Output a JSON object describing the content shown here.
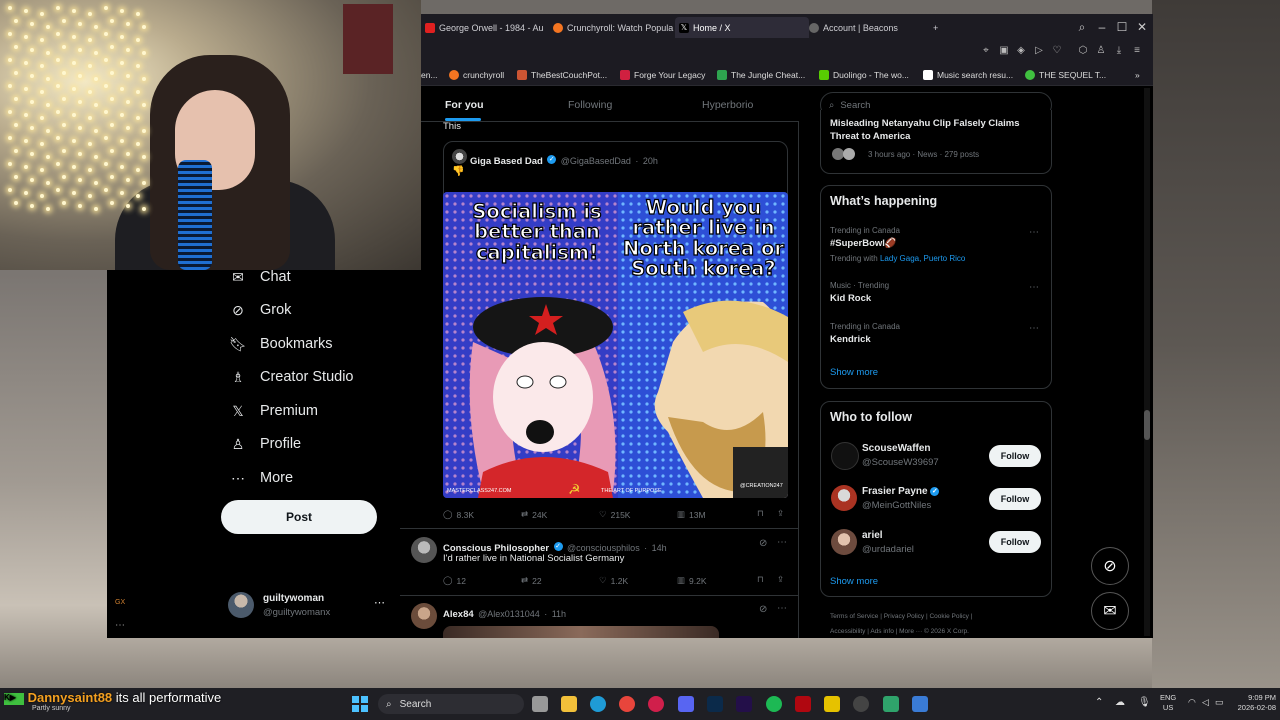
{
  "browser": {
    "tabs": [
      {
        "label": "George Orwell - 1984 - Au",
        "color": "#e02020"
      },
      {
        "label": "Crunchyroll: Watch Popula",
        "color": "#f47521"
      },
      {
        "label": "Home / X",
        "color": "#ffffff"
      },
      {
        "label": "Account | Beacons",
        "color": "#888888"
      }
    ],
    "bookmarks": [
      {
        "label": "en...",
        "color": "#888888"
      },
      {
        "label": "crunchyroll",
        "color": "#f47521"
      },
      {
        "label": "TheBestCouchPot...",
        "color": "#cc5533"
      },
      {
        "label": "Forge Your Legacy",
        "color": "#d02040"
      },
      {
        "label": "The Jungle Cheat...",
        "color": "#2ea44f"
      },
      {
        "label": "Duolingo - The wo...",
        "color": "#58cc02"
      },
      {
        "label": "Music search resu...",
        "color": "#ffffff"
      },
      {
        "label": "THE SEQUEL T...",
        "color": "#ff3333"
      }
    ]
  },
  "nav": {
    "items": [
      {
        "label": "Chat",
        "icon": "chat-icon"
      },
      {
        "label": "Grok",
        "icon": "grok-icon"
      },
      {
        "label": "Bookmarks",
        "icon": "bookmark-icon"
      },
      {
        "label": "Creator Studio",
        "icon": "creator-icon"
      },
      {
        "label": "Premium",
        "icon": "x-logo-icon"
      },
      {
        "label": "Profile",
        "icon": "profile-icon"
      },
      {
        "label": "More",
        "icon": "more-icon"
      }
    ],
    "post_label": "Post",
    "account_name": "guiltywoman",
    "account_handle": "@guiltywomanx",
    "gx_label": "GX"
  },
  "feed": {
    "tabs": [
      "For you",
      "Following",
      "Hyperborio"
    ],
    "quote_text": "This",
    "quoted": {
      "name": "Giga Based Dad",
      "handle": "@GigaBasedDad",
      "time": "20h",
      "emoji": "👎",
      "meme_left": "Socialism is better than capitalism!",
      "meme_right": "Would you rather live in North korea or South korea?",
      "meme_wm_left": "MASTERCLASS247.COM",
      "meme_wm_mid": "THE ART OF PURPOSE",
      "meme_wm_right": "@CREATION247"
    },
    "post1_stats": {
      "replies": "8.3K",
      "reposts": "24K",
      "likes": "215K",
      "views": "13M"
    },
    "post2": {
      "name": "Conscious Philosopher",
      "handle": "@consciousphilos",
      "time": "14h",
      "text": "I'd rather live in National Socialist Germany",
      "replies": "12",
      "reposts": "22",
      "likes": "1.2K",
      "views": "9.2K"
    },
    "post3": {
      "name": "Alex84",
      "handle": "@Alex0131044",
      "time": "11h"
    }
  },
  "right": {
    "search_placeholder": "Search",
    "news": {
      "title": "Misleading Netanyahu Clip Falsely Claims Threat to America",
      "meta": "3 hours ago · News · 279 posts"
    },
    "whats_happening": "What’s happening",
    "trends": [
      {
        "meta": "Trending in Canada",
        "title": "#SuperBowl🏈",
        "extra_prefix": "Trending with",
        "extra_links": "Lady Gaga, Puerto Rico"
      },
      {
        "meta": "Music · Trending",
        "title": "Kid Rock"
      },
      {
        "meta": "Trending in Canada",
        "title": "Kendrick"
      }
    ],
    "show_more": "Show more",
    "who_to_follow": "Who to follow",
    "follows": [
      {
        "name": "ScouseWaffen",
        "handle": "@ScouseW39697"
      },
      {
        "name": "Frasier Payne",
        "handle": "@MeinGottNiles"
      },
      {
        "name": "ariel",
        "handle": "@urdadariel"
      }
    ],
    "follow_label": "Follow",
    "show_more2": "Show more",
    "footer1": "Terms of Service  |  Privacy Policy  |  Cookie Policy  |",
    "footer2": "Accessibility  |  Ads info  |  More ···  © 2026 X Corp."
  },
  "taskbar": {
    "chat_user": "Dannysaint88",
    "chat_message": "its all performative",
    "weather": "Partly sunny",
    "search": "Search",
    "lang": "ENG",
    "region": "US",
    "time": "9:09 PM",
    "date": "2026-02-08"
  }
}
